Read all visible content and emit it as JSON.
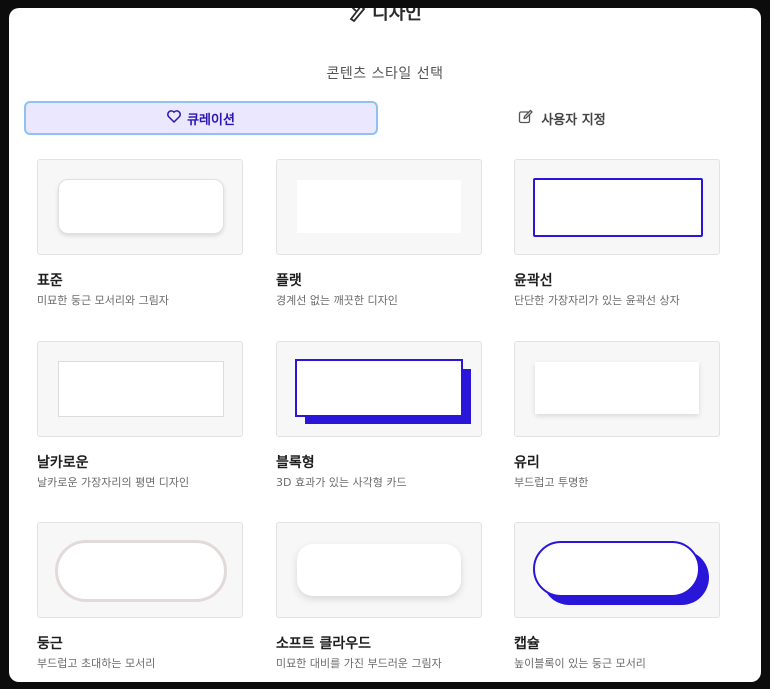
{
  "header": {
    "title": "디자인",
    "icon": "design-pen-icon"
  },
  "subtitle": "콘텐츠 스타일 선택",
  "tabs": {
    "curation": {
      "label": "큐레이션",
      "icon": "heart-icon"
    },
    "custom": {
      "label": "사용자 지정",
      "icon": "edit-icon"
    }
  },
  "colors": {
    "accent": "#2a16d9",
    "tab_bg": "#ebe7ff",
    "tab_border": "#8dc3ee"
  },
  "styles": [
    {
      "title": "표준",
      "desc": "미묘한 둥근 모서리와 그림자"
    },
    {
      "title": "플랫",
      "desc": "경계선 없는 깨끗한 디자인"
    },
    {
      "title": "윤곽선",
      "desc": "단단한 가장자리가 있는 윤곽선 상자"
    },
    {
      "title": "날카로운",
      "desc": "날카로운 가장자리의 평면 디자인"
    },
    {
      "title": "블록형",
      "desc": "3D 효과가 있는 사각형 카드"
    },
    {
      "title": "유리",
      "desc": "부드럽고 투명한"
    },
    {
      "title": "둥근",
      "desc": "부드럽고 초대하는 모서리"
    },
    {
      "title": "소프트 클라우드",
      "desc": "미묘한 대비를 가진 부드러운 그림자"
    },
    {
      "title": "캡슐",
      "desc": "높이블록이 있는 둥근 모서리"
    }
  ]
}
